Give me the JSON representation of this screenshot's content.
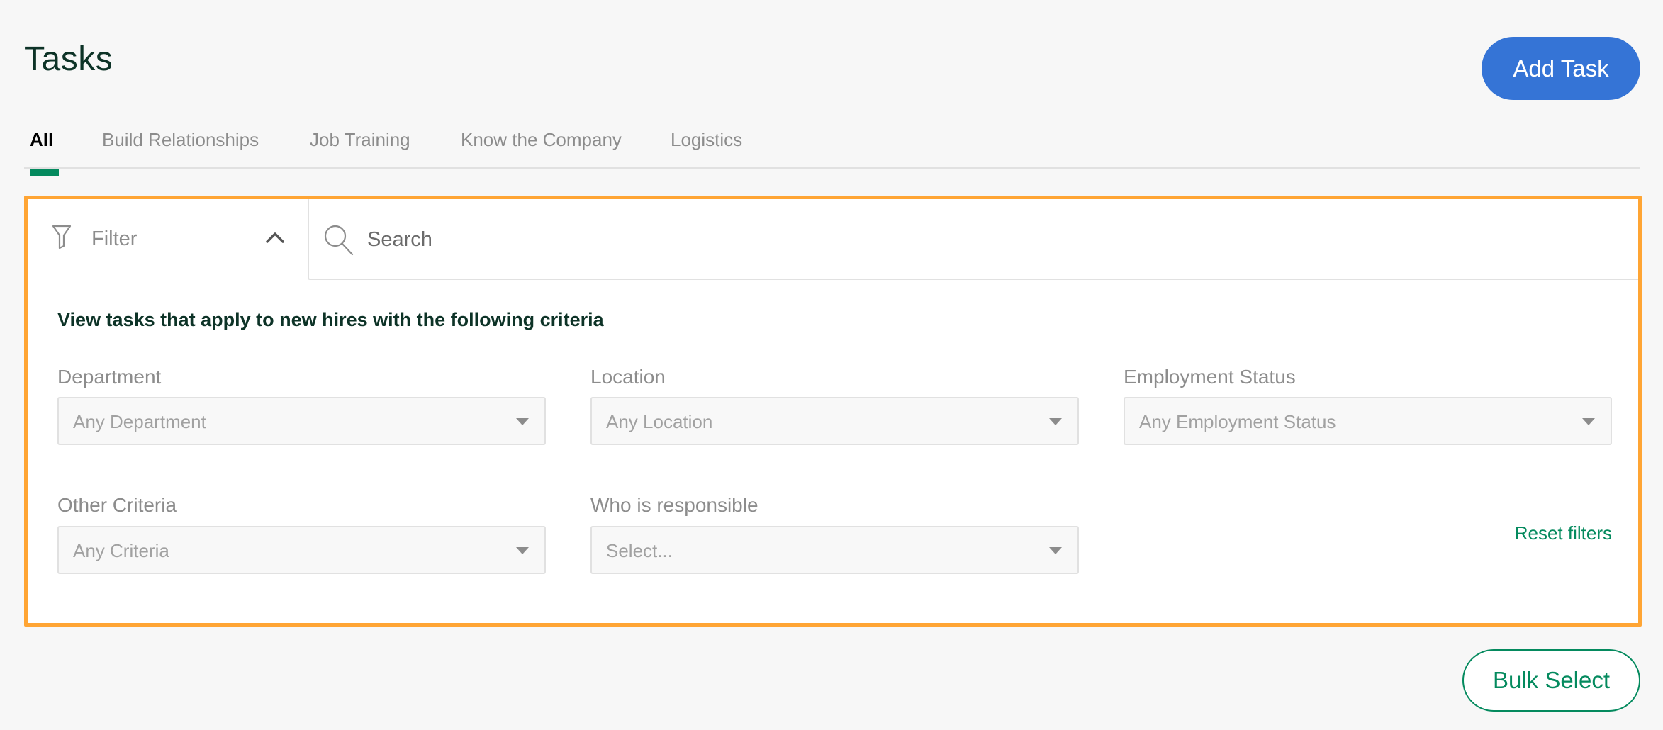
{
  "header": {
    "title": "Tasks",
    "add_task_label": "Add Task"
  },
  "tabs": [
    {
      "label": "All",
      "active": true
    },
    {
      "label": "Build Relationships",
      "active": false
    },
    {
      "label": "Job Training",
      "active": false
    },
    {
      "label": "Know the Company",
      "active": false
    },
    {
      "label": "Logistics",
      "active": false
    }
  ],
  "filter_panel": {
    "filter_label": "Filter",
    "search_placeholder": "Search",
    "search_value": "",
    "heading": "View tasks that apply to new hires with the following criteria",
    "fields": [
      {
        "label": "Department",
        "value": "Any Department"
      },
      {
        "label": "Location",
        "value": "Any Location"
      },
      {
        "label": "Employment Status",
        "value": "Any Employment Status"
      },
      {
        "label": "Other Criteria",
        "value": "Any Criteria"
      },
      {
        "label": "Who is responsible",
        "value": "Select..."
      }
    ],
    "reset_label": "Reset filters"
  },
  "bulk_select_label": "Bulk Select",
  "colors": {
    "primary_blue": "#3574d6",
    "accent_green": "#048a5e",
    "highlight_orange": "#ffa534",
    "title_dark_green": "#0d3327"
  }
}
